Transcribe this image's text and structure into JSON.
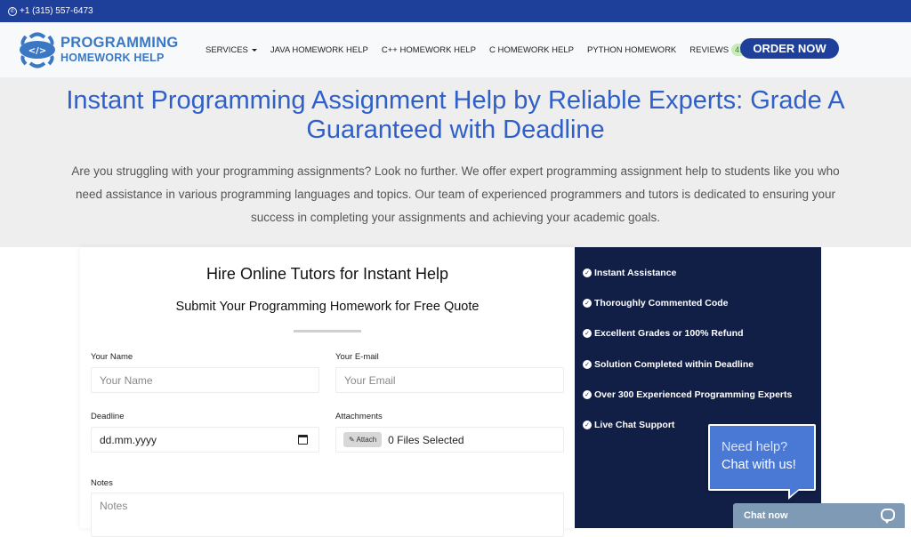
{
  "topbar": {
    "phone": "+1 (315) 557-6473",
    "phone_icon": "whatsapp-icon"
  },
  "logo": {
    "line1": "PROGRAMMING",
    "line2": "HOMEWORK HELP",
    "glyph": "</>"
  },
  "nav": {
    "items": [
      {
        "label": "SERVICES",
        "dropdown": true
      },
      {
        "label": "JAVA HOMEWORK HELP"
      },
      {
        "label": "C++ HOMEWORK HELP"
      },
      {
        "label": "C HOMEWORK HELP"
      },
      {
        "label": "PYTHON HOMEWORK"
      },
      {
        "label": "REVIEWS",
        "badge": "4.8/5"
      }
    ],
    "order_button": "ORDER NOW"
  },
  "hero": {
    "title": "Instant Programming Assignment Help by Reliable Experts: Grade A Guaranteed with Deadline",
    "description": "Are you struggling with your programming assignments? Look no further. We offer expert programming assignment help to students like you who need assistance in various programming languages and topics. Our team of experienced programmers and tutors is dedicated to ensuring your success in completing your assignments and achieving your academic goals."
  },
  "form": {
    "title": "Hire Online Tutors for Instant Help",
    "subtitle": "Submit Your Programming Homework for Free Quote",
    "name": {
      "label": "Your Name",
      "placeholder": "Your Name"
    },
    "email": {
      "label": "Your E-mail",
      "placeholder": "Your Email"
    },
    "deadline": {
      "label": "Deadline",
      "value": "dd.mm.yyyy"
    },
    "attachments": {
      "label": "Attachments",
      "button": "✎ Attach",
      "status": "0 Files Selected"
    },
    "notes": {
      "label": "Notes",
      "placeholder": "Notes"
    }
  },
  "features": [
    "Instant Assistance",
    "Thoroughly Commented Code",
    "Excellent Grades or 100% Refund",
    "Solution Completed within Deadline",
    "Over 300 Experienced Programming Experts",
    "Live Chat Support"
  ],
  "chat": {
    "bubble_question": "Need help?",
    "bubble_cta": "Chat with us!",
    "bar_label": "Chat now"
  },
  "colors": {
    "brand_blue": "#1e3f9a",
    "heading_blue": "#2f5fc8",
    "panel_navy": "#111e45",
    "badge_green": "#c6ecb9",
    "chat_bubble": "#4a78d5",
    "chat_bar": "#7f9ab5"
  }
}
